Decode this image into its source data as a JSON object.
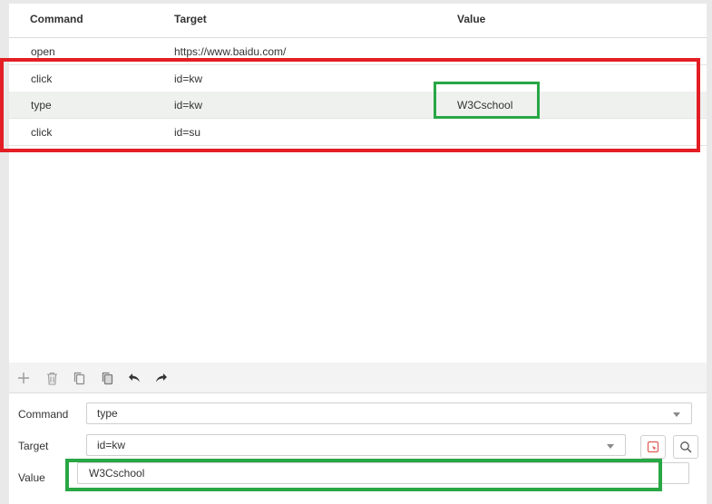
{
  "table": {
    "headers": {
      "command": "Command",
      "target": "Target",
      "value": "Value"
    },
    "rows": [
      {
        "command": "open",
        "target": "https://www.baidu.com/",
        "value": ""
      },
      {
        "command": "click",
        "target": "id=kw",
        "value": ""
      },
      {
        "command": "type",
        "target": "id=kw",
        "value": "W3Cschool"
      },
      {
        "command": "click",
        "target": "id=su",
        "value": ""
      }
    ],
    "selected_row_index": 2
  },
  "toolbar": {
    "icons": [
      "plus-icon",
      "trash-icon",
      "copy-icon",
      "paste-icon",
      "undo-icon",
      "redo-icon"
    ]
  },
  "form": {
    "command_label": "Command",
    "command_value": "type",
    "target_label": "Target",
    "target_value": "id=kw",
    "value_label": "Value",
    "value_value": "W3Cschool"
  },
  "colors": {
    "highlight_red": "#e31e24",
    "highlight_green": "#28a745",
    "selected_row": "#eef1ee",
    "toolbar_bg": "#f3f3f3"
  }
}
